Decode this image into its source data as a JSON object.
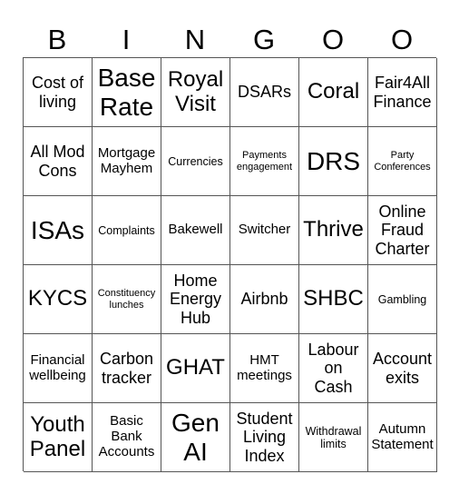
{
  "header": {
    "letters": [
      "B",
      "I",
      "N",
      "G",
      "O",
      "O"
    ]
  },
  "board": {
    "rows": [
      [
        "Cost of\nliving",
        "Base\nRate",
        "Royal\nVisit",
        "DSARs",
        "Coral",
        "Fair4All\nFinance"
      ],
      [
        "All Mod\nCons",
        "Mortgage\nMayhem",
        "Currencies",
        "Payments\nengagement",
        "DRS",
        "Party\nConferences"
      ],
      [
        "ISAs",
        "Complaints",
        "Bakewell",
        "Switcher",
        "Thrive",
        "Online\nFraud\nCharter"
      ],
      [
        "KYCS",
        "Constituency\nlunches",
        "Home\nEnergy\nHub",
        "Airbnb",
        "SHBC",
        "Gambling"
      ],
      [
        "Financial\nwellbeing",
        "Carbon\ntracker",
        "GHAT",
        "HMT\nmeetings",
        "Labour\non\nCash",
        "Account\nexits"
      ],
      [
        "Youth\nPanel",
        "Basic\nBank\nAccounts",
        "Gen\nAI",
        "Student\nLiving\nIndex",
        "Withdrawal\nlimits",
        "Autumn\nStatement"
      ]
    ]
  }
}
